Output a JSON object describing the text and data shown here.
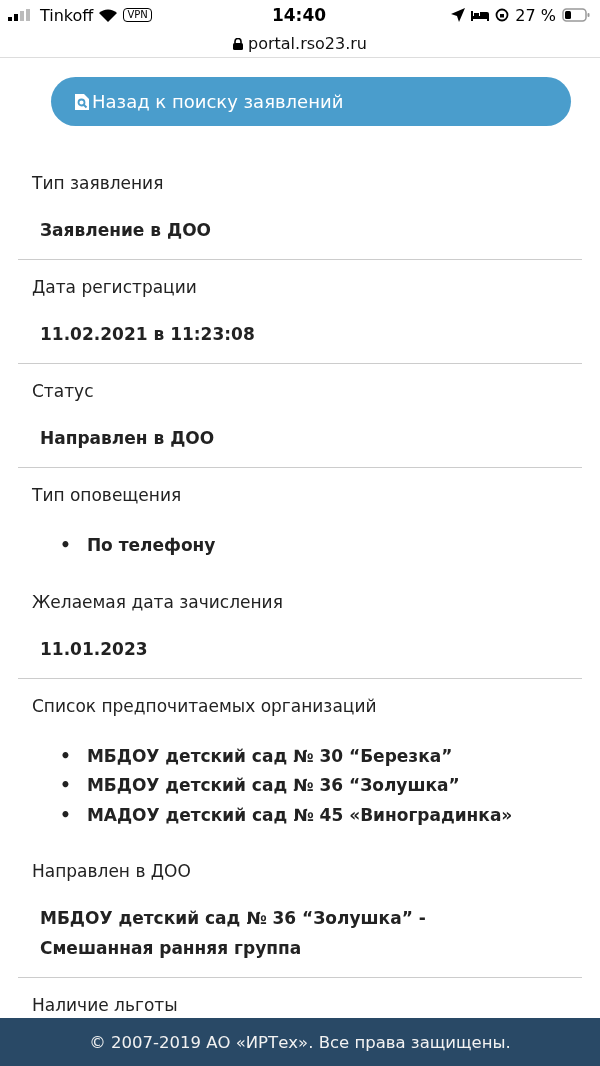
{
  "status_bar": {
    "carrier": "Tinkoff",
    "vpn": "VPN",
    "time": "14:40",
    "battery": "27 %"
  },
  "address_bar": {
    "url": "portal.rso23.ru"
  },
  "back_button": {
    "label": "Назад к поиску заявлений"
  },
  "sections": [
    {
      "kind": "value",
      "label": "Тип заявления",
      "value": "Заявление в ДОО",
      "divider": true
    },
    {
      "kind": "value",
      "label": "Дата регистрации",
      "value": "11.02.2021 в 11:23:08",
      "divider": true
    },
    {
      "kind": "value",
      "label": "Статус",
      "value": "Направлен в ДОО",
      "divider": true
    },
    {
      "kind": "list",
      "label": "Тип оповещения",
      "marker": "•",
      "items": [
        "По телефону"
      ],
      "divider": false
    },
    {
      "kind": "value",
      "label": "Желаемая дата зачисления",
      "value": "11.01.2023",
      "divider": true
    },
    {
      "kind": "list",
      "label": "Список предпочитаемых организаций",
      "marker": "•",
      "items": [
        "МБДОУ детский сад № 30 “Березка”",
        "МБДОУ детский сад № 36 “Золушка”",
        "МАДОУ детский сад № 45 «Виноградинка»"
      ],
      "divider": false
    },
    {
      "kind": "value",
      "label": "Направлен в ДОО",
      "value": "МБДОУ детский сад № 36 “Золушка” - Смешанная ранняя группа",
      "divider": true
    },
    {
      "kind": "label",
      "label": "Наличие льготы",
      "divider": false
    }
  ],
  "footer": {
    "text": "© 2007-2019 АО «ИРТех». Все права защищены."
  }
}
